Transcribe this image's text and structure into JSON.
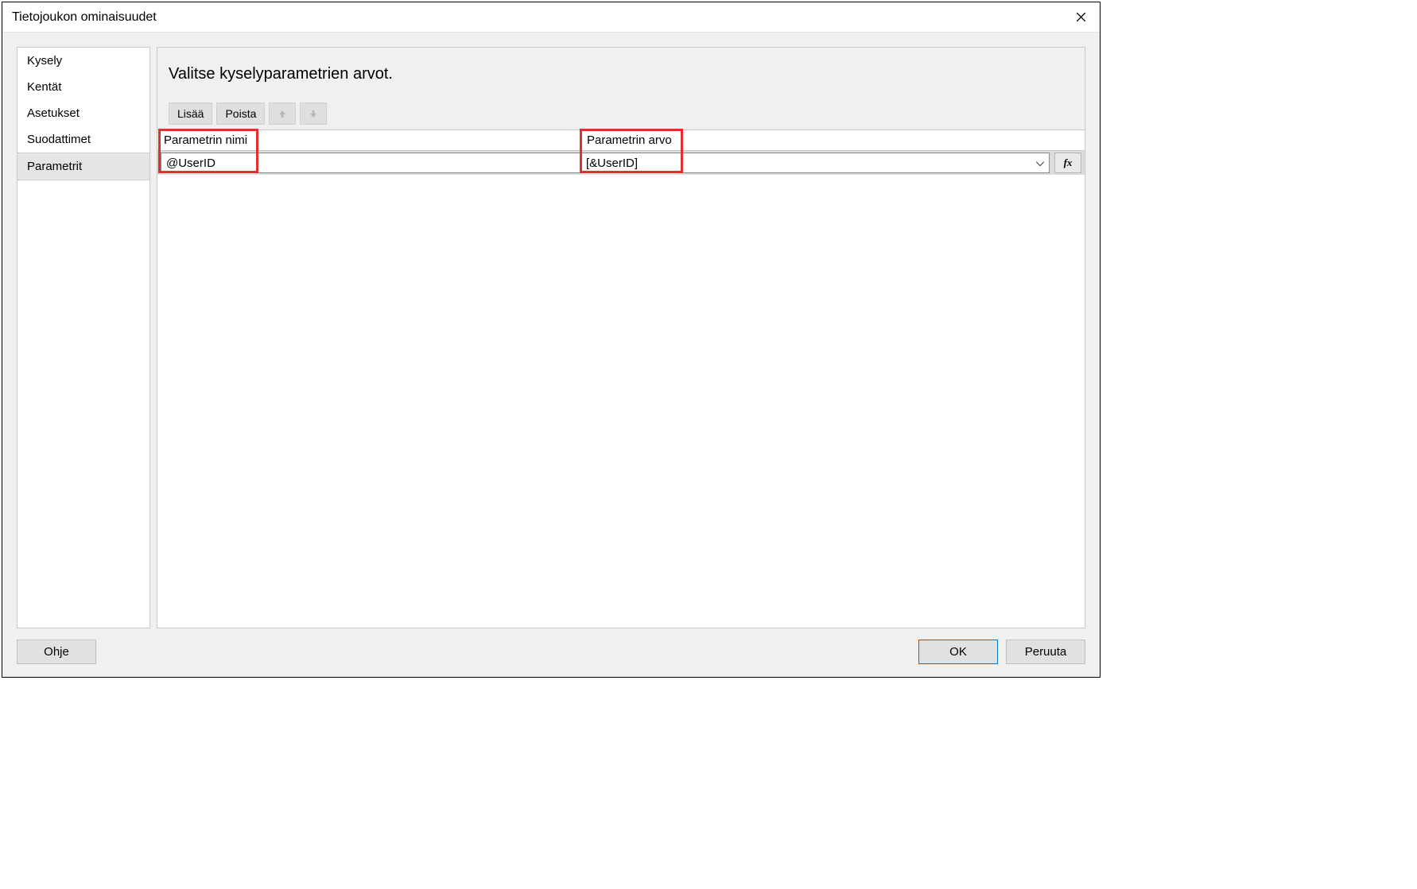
{
  "titlebar": {
    "title": "Tietojoukon ominaisuudet"
  },
  "sidebar": {
    "items": [
      {
        "label": "Kysely",
        "selected": false
      },
      {
        "label": "Kentät",
        "selected": false
      },
      {
        "label": "Asetukset",
        "selected": false
      },
      {
        "label": "Suodattimet",
        "selected": false
      },
      {
        "label": "Parametrit",
        "selected": true
      }
    ]
  },
  "panel": {
    "heading": "Valitse kyselyparametrien arvot.",
    "toolbar": {
      "add_label": "Lisää",
      "delete_label": "Poista"
    },
    "columns": {
      "name": "Parametrin nimi",
      "value": "Parametrin arvo"
    },
    "rows": [
      {
        "name": "@UserID",
        "value": "[&UserID]"
      }
    ],
    "fx_label": "fx"
  },
  "footer": {
    "help_label": "Ohje",
    "ok_label": "OK",
    "cancel_label": "Peruuta"
  }
}
